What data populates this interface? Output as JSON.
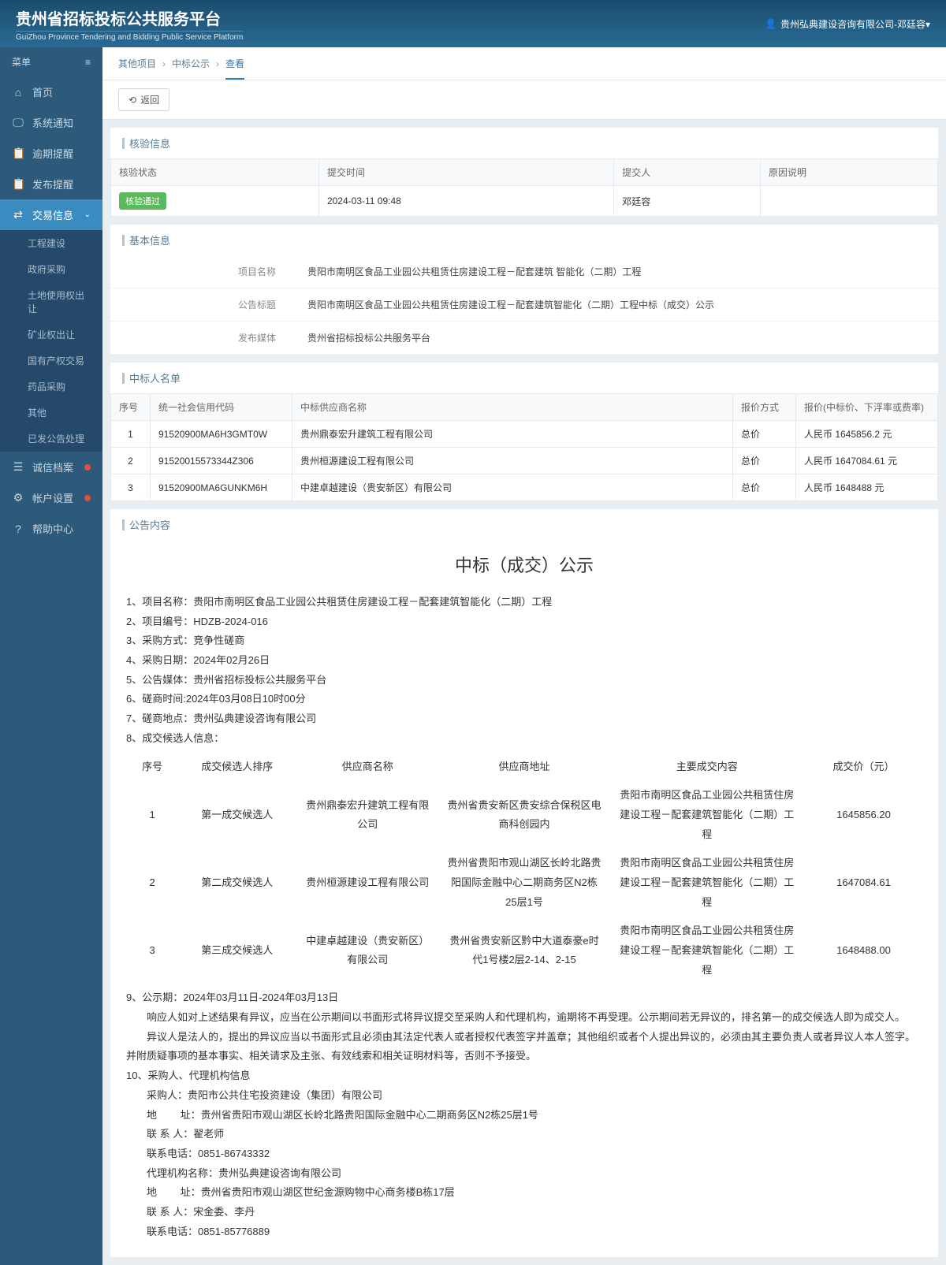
{
  "header": {
    "title": "贵州省招标投标公共服务平台",
    "subtitle": "GuiZhou Province Tendering and Bidding Public Service Platform",
    "user": "贵州弘典建设咨询有限公司-邓廷容▾"
  },
  "menu": {
    "label": "菜单",
    "items": [
      {
        "icon": "⌂",
        "label": "首页"
      },
      {
        "icon": "🖵",
        "label": "系统通知"
      },
      {
        "icon": "📋",
        "label": "逾期提醒"
      },
      {
        "icon": "📋",
        "label": "发布提醒"
      },
      {
        "icon": "⇄",
        "label": "交易信息",
        "active": true,
        "expand": true
      },
      {
        "icon": "☰",
        "label": "诚信档案",
        "dot": true
      },
      {
        "icon": "⚙",
        "label": "帐户设置",
        "dot": true
      },
      {
        "icon": "?",
        "label": "帮助中心"
      }
    ],
    "submenu": [
      "工程建设",
      "政府采购",
      "土地使用权出让",
      "矿业权出让",
      "国有产权交易",
      "药品采购",
      "其他",
      "已发公告处理"
    ]
  },
  "breadcrumb": [
    "其他项目",
    "中标公示",
    "查看"
  ],
  "backBtn": "返回",
  "verify": {
    "title": "核验信息",
    "headers": [
      "核验状态",
      "提交时间",
      "提交人",
      "原因说明"
    ],
    "status": "核验通过",
    "time": "2024-03-11 09:48",
    "person": "邓廷容",
    "reason": ""
  },
  "basic": {
    "title": "基本信息",
    "rows": [
      {
        "label": "项目名称",
        "value": "贵阳市南明区食品工业园公共租赁住房建设工程－配套建筑 智能化（二期）工程"
      },
      {
        "label": "公告标题",
        "value": "贵阳市南明区食品工业园公共租赁住房建设工程－配套建筑智能化（二期）工程中标（成交）公示"
      },
      {
        "label": "发布媒体",
        "value": "贵州省招标投标公共服务平台"
      }
    ]
  },
  "bidders": {
    "title": "中标人名单",
    "headers": [
      "序号",
      "统一社会信用代码",
      "中标供应商名称",
      "报价方式",
      "报价(中标价、下浮率或费率)"
    ],
    "rows": [
      {
        "no": "1",
        "code": "91520900MA6H3GMT0W",
        "name": "贵州鼎泰宏升建筑工程有限公司",
        "method": "总价",
        "price": "人民币 1645856.2 元"
      },
      {
        "no": "2",
        "code": "91520015573344Z306",
        "name": "贵州桓源建设工程有限公司",
        "method": "总价",
        "price": "人民币 1647084.61 元"
      },
      {
        "no": "3",
        "code": "91520900MA6GUNKM6H",
        "name": "中建卓越建设（贵安新区）有限公司",
        "method": "总价",
        "price": "人民币 1648488 元"
      }
    ]
  },
  "announce": {
    "section": "公告内容",
    "title": "中标（成交）公示",
    "lines": [
      "1、项目名称：贵阳市南明区食品工业园公共租赁住房建设工程－配套建筑智能化（二期）工程",
      "2、项目编号：HDZB-2024-016",
      "3、采购方式：竞争性磋商",
      "4、采购日期：2024年02月26日",
      "5、公告媒体：贵州省招标投标公共服务平台",
      "6、磋商时间:2024年03月08日10时00分",
      "7、磋商地点：贵州弘典建设咨询有限公司",
      "8、成交候选人信息："
    ],
    "tbl": {
      "headers": [
        "序号",
        "成交候选人排序",
        "供应商名称",
        "供应商地址",
        "主要成交内容",
        "成交价（元）"
      ],
      "rows": [
        {
          "no": "1",
          "rank": "第一成交候选人",
          "name": "贵州鼎泰宏升建筑工程有限公司",
          "addr": "贵州省贵安新区贵安综合保税区电商科创园内",
          "content": "贵阳市南明区食品工业园公共租赁住房建设工程－配套建筑智能化（二期）工程",
          "price": "1645856.20"
        },
        {
          "no": "2",
          "rank": "第二成交候选人",
          "name": "贵州桓源建设工程有限公司",
          "addr": "贵州省贵阳市观山湖区长岭北路贵阳国际金融中心二期商务区N2栋25层1号",
          "content": "贵阳市南明区食品工业园公共租赁住房建设工程－配套建筑智能化（二期）工程",
          "price": "1647084.61"
        },
        {
          "no": "3",
          "rank": "第三成交候选人",
          "name": "中建卓越建设（贵安新区）有限公司",
          "addr": "贵州省贵安新区黔中大道泰豪e时代1号楼2层2-14、2-15",
          "content": "贵阳市南明区食品工业园公共租赁住房建设工程－配套建筑智能化（二期）工程",
          "price": "1648488.00"
        }
      ]
    },
    "after": [
      "9、公示期：2024年03月11日-2024年03月13日",
      "　　响应人如对上述结果有异议，应当在公示期间以书面形式将异议提交至采购人和代理机构，逾期将不再受理。公示期间若无异议的，排名第一的成交候选人即为成交人。",
      "　　异议人是法人的，提出的异议应当以书面形式且必须由其法定代表人或者授权代表签字并盖章；其他组织或者个人提出异议的，必须由其主要负责人或者异议人本人签字。并附质疑事项的基本事实、相关请求及主张、有效线索和相关证明材料等，否则不予接受。",
      "10、采购人、代理机构信息",
      "　　采购人：贵阳市公共住宅投资建设（集团）有限公司",
      "　　地　　 址：贵州省贵阳市观山湖区长岭北路贵阳国际金融中心二期商务区N2栋25层1号",
      "　　联 系 人：翟老师",
      "　　联系电话：0851-86743332",
      "　　代理机构名称：贵州弘典建设咨询有限公司",
      "　　地　　 址：贵州省贵阳市观山湖区世纪金源购物中心商务楼B栋17层",
      "　　联 系 人：宋金委、李丹",
      "　　联系电话：0851-85776889"
    ]
  }
}
